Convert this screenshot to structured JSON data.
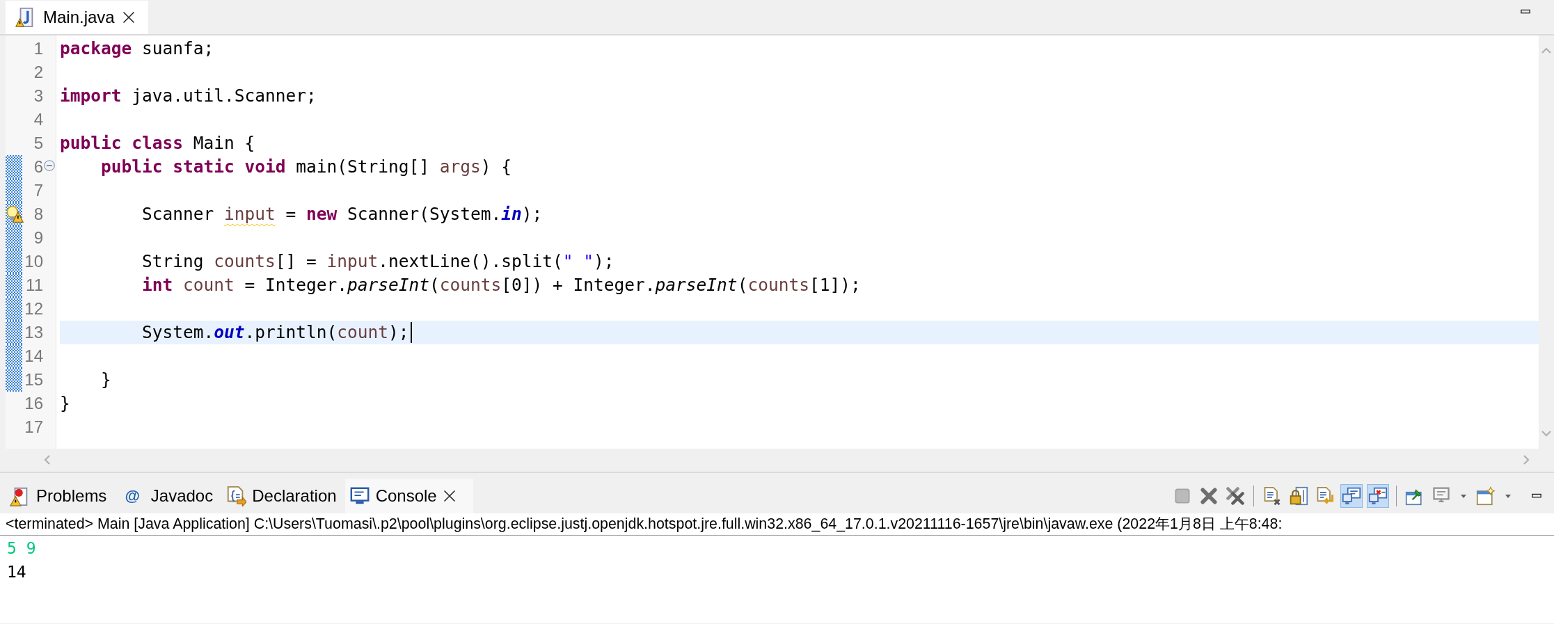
{
  "editor": {
    "tabs": [
      {
        "label": "Main.java",
        "selected": true
      }
    ],
    "lines": [
      {
        "number": "1",
        "changed": false,
        "current": false,
        "fold": false,
        "warning": false,
        "tokens": [
          {
            "kind": "keyword",
            "text": "package"
          },
          {
            "kind": "text",
            "text": " suanfa;"
          }
        ]
      },
      {
        "number": "2",
        "changed": false,
        "current": false,
        "fold": false,
        "warning": false
      },
      {
        "number": "3",
        "changed": false,
        "current": false,
        "fold": false,
        "warning": false,
        "tokens": [
          {
            "kind": "keyword",
            "text": "import"
          },
          {
            "kind": "text",
            "text": " java.util.Scanner;"
          }
        ]
      },
      {
        "number": "4",
        "changed": false,
        "current": false,
        "fold": false,
        "warning": false
      },
      {
        "number": "5",
        "changed": false,
        "current": false,
        "fold": false,
        "warning": false,
        "tokens": [
          {
            "kind": "keyword",
            "text": "public class"
          },
          {
            "kind": "text",
            "text": " Main {"
          }
        ]
      },
      {
        "number": "6",
        "changed": true,
        "current": false,
        "fold": true,
        "warning": false,
        "tokens": [
          {
            "kind": "keyword",
            "text": "    public static void"
          },
          {
            "kind": "text",
            "text": " main(String[] "
          },
          {
            "kind": "local",
            "text": "args"
          },
          {
            "kind": "text",
            "text": ") {"
          }
        ]
      },
      {
        "number": "7",
        "changed": true,
        "current": false,
        "fold": false,
        "warning": false
      },
      {
        "number": "8",
        "changed": true,
        "current": false,
        "fold": false,
        "warning": true,
        "tokens": [
          {
            "kind": "text",
            "text": "        Scanner "
          },
          {
            "kind": "local-warning",
            "text": "input"
          },
          {
            "kind": "text",
            "text": " = "
          },
          {
            "kind": "keyword",
            "text": "new"
          },
          {
            "kind": "text",
            "text": " Scanner(System."
          },
          {
            "kind": "static-field",
            "text": "in"
          },
          {
            "kind": "text",
            "text": ");"
          }
        ]
      },
      {
        "number": "9",
        "changed": true,
        "current": false,
        "fold": false,
        "warning": false
      },
      {
        "number": "10",
        "changed": true,
        "current": false,
        "fold": false,
        "warning": false,
        "tokens": [
          {
            "kind": "text",
            "text": "        String "
          },
          {
            "kind": "local",
            "text": "counts"
          },
          {
            "kind": "text",
            "text": "[] = "
          },
          {
            "kind": "local",
            "text": "input"
          },
          {
            "kind": "text",
            "text": ".nextLine().split("
          },
          {
            "kind": "string",
            "text": "\" \""
          },
          {
            "kind": "text",
            "text": ");"
          }
        ]
      },
      {
        "number": "11",
        "changed": true,
        "current": false,
        "fold": false,
        "warning": false,
        "tokens": [
          {
            "kind": "keyword",
            "text": "        int"
          },
          {
            "kind": "local",
            "text": " count"
          },
          {
            "kind": "text",
            "text": " = Integer."
          },
          {
            "kind": "static-method",
            "text": "parseInt"
          },
          {
            "kind": "text",
            "text": "("
          },
          {
            "kind": "local",
            "text": "counts"
          },
          {
            "kind": "text",
            "text": "[0]) + Integer."
          },
          {
            "kind": "static-method",
            "text": "parseInt"
          },
          {
            "kind": "text",
            "text": "("
          },
          {
            "kind": "local",
            "text": "counts"
          },
          {
            "kind": "text",
            "text": "[1]);"
          }
        ]
      },
      {
        "number": "12",
        "changed": true,
        "current": false,
        "fold": false,
        "warning": false
      },
      {
        "number": "13",
        "changed": true,
        "current": true,
        "fold": false,
        "warning": false,
        "tokens": [
          {
            "kind": "text",
            "text": "        System."
          },
          {
            "kind": "static-field",
            "text": "out"
          },
          {
            "kind": "text",
            "text": ".println("
          },
          {
            "kind": "local",
            "text": "count"
          },
          {
            "kind": "text",
            "text": ");"
          }
        ]
      },
      {
        "number": "14",
        "changed": true,
        "current": false,
        "fold": false,
        "warning": false
      },
      {
        "number": "15",
        "changed": true,
        "current": false,
        "fold": false,
        "warning": false,
        "tokens": [
          {
            "kind": "text",
            "text": "    }"
          }
        ]
      },
      {
        "number": "16",
        "changed": false,
        "current": false,
        "fold": false,
        "warning": false,
        "tokens": [
          {
            "kind": "text",
            "text": "}"
          }
        ]
      },
      {
        "number": "17",
        "changed": false,
        "current": false,
        "fold": false,
        "warning": false
      }
    ]
  },
  "console": {
    "tabs": [
      {
        "kind": "problems",
        "label": "Problems",
        "selected": false
      },
      {
        "kind": "javadoc",
        "glyph": "@",
        "label": "Javadoc",
        "selected": false
      },
      {
        "kind": "declaration",
        "label": "Declaration",
        "selected": false
      },
      {
        "kind": "console",
        "label": "Console",
        "selected": true
      }
    ],
    "toolbar": [
      {
        "kind": "terminate",
        "pressed": false,
        "disabled": true
      },
      {
        "kind": "remove",
        "pressed": false,
        "disabled": false
      },
      {
        "kind": "remove-all",
        "pressed": false,
        "disabled": false
      },
      {
        "kind": "separator"
      },
      {
        "kind": "clear",
        "pressed": false,
        "disabled": false
      },
      {
        "kind": "scroll-lock",
        "pressed": false,
        "disabled": false
      },
      {
        "kind": "word-wrap",
        "pressed": false,
        "disabled": false
      },
      {
        "kind": "stdout",
        "pressed": true,
        "disabled": false
      },
      {
        "kind": "stderr",
        "pressed": true,
        "disabled": false
      },
      {
        "kind": "separator"
      },
      {
        "kind": "pin",
        "pressed": false,
        "disabled": false
      },
      {
        "kind": "display",
        "pressed": false,
        "disabled": false
      },
      {
        "kind": "dropdown",
        "pressed": false,
        "disabled": false
      },
      {
        "kind": "open-console",
        "pressed": false,
        "disabled": false
      },
      {
        "kind": "dropdown",
        "pressed": false,
        "disabled": false
      }
    ],
    "header": "<terminated> Main [Java Application] C:\\Users\\Tuomasi\\.p2\\pool\\plugins\\org.eclipse.justj.openjdk.hotspot.jre.full.win32.x86_64_17.0.1.v20211116-1657\\jre\\bin\\javaw.exe  (2022年1月8日 上午8:48:",
    "output": [
      {
        "kind": "input",
        "text": "5 9"
      },
      {
        "kind": "output",
        "text": "14"
      }
    ]
  }
}
